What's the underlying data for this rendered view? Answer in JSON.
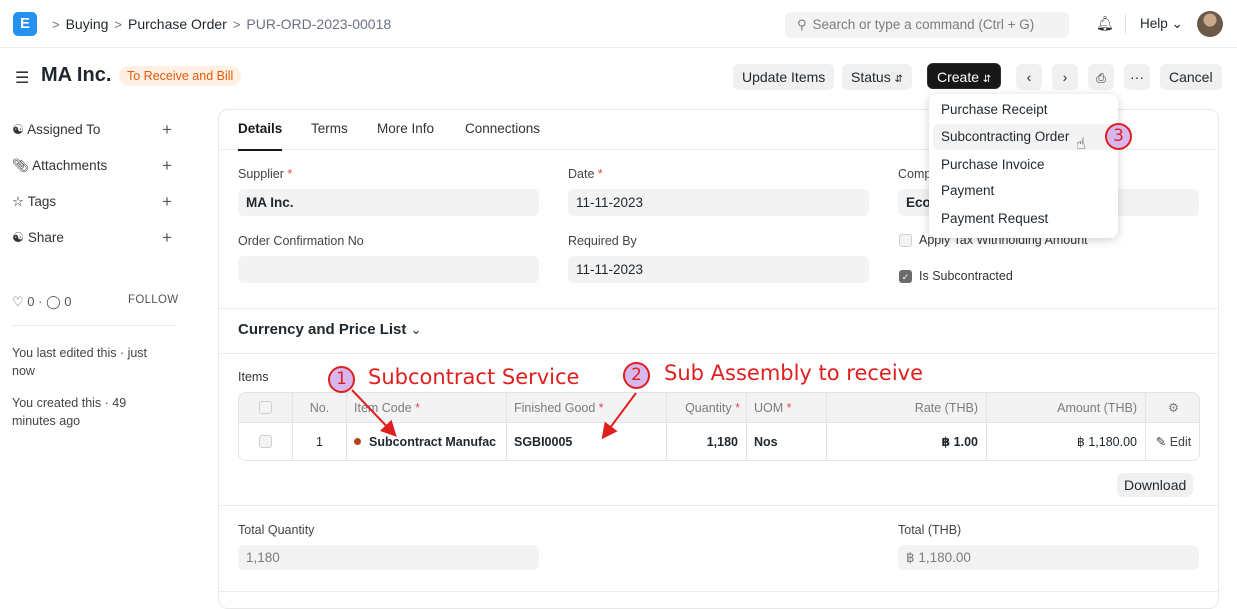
{
  "nav": {
    "logo": "E",
    "breadcrumbs": [
      "Buying",
      "Purchase Order",
      "PUR-ORD-2023-00018"
    ],
    "search_placeholder": "Search or type a command (Ctrl + G)",
    "help": "Help"
  },
  "header": {
    "title": "MA Inc.",
    "status": "To Receive and Bill",
    "buttons": {
      "update_items": "Update Items",
      "status": "Status",
      "create": "Create",
      "cancel": "Cancel",
      "more": "···"
    }
  },
  "sidebar": {
    "items": [
      {
        "label": "Assigned To"
      },
      {
        "label": "Attachments"
      },
      {
        "label": "Tags"
      },
      {
        "label": "Share"
      }
    ],
    "likes": "0",
    "comments": "0",
    "follow": "FOLLOW",
    "last_edited": "You last edited this · just now",
    "created": "You created this · 49 minutes ago"
  },
  "tabs": [
    "Details",
    "Terms",
    "More Info",
    "Connections"
  ],
  "form": {
    "supplier_label": "Supplier",
    "supplier_value": "MA Inc.",
    "date_label": "Date",
    "date_value": "11-11-2023",
    "company_label": "Comp",
    "company_value": "Eco",
    "order_conf_label": "Order Confirmation No",
    "order_conf_value": "",
    "required_by_label": "Required By",
    "required_by_value": "11-11-2023",
    "apply_tax_label": "Apply Tax Withholding Amount",
    "apply_tax_checked": false,
    "is_subcontracted_label": "Is Subcontracted",
    "is_subcontracted_checked": true
  },
  "currency_section": "Currency and Price List",
  "items_table": {
    "label": "Items",
    "columns": [
      "No.",
      "Item Code",
      "Finished Good",
      "Quantity",
      "UOM",
      "Rate (THB)",
      "Amount (THB)"
    ],
    "rows": [
      {
        "no": "1",
        "item_code": "Subcontract Manufac",
        "finished_good": "SGBI0005",
        "quantity": "1,180",
        "uom": "Nos",
        "rate": "฿ 1.00",
        "amount": "฿ 1,180.00",
        "edit": "Edit"
      }
    ],
    "download": "Download"
  },
  "totals": {
    "qty_label": "Total Quantity",
    "qty_value": "1,180",
    "total_label": "Total (THB)",
    "total_value": "฿ 1,180.00"
  },
  "create_menu": [
    "Purchase Receipt",
    "Subcontracting Order",
    "Purchase Invoice",
    "Payment",
    "Payment Request"
  ],
  "annotations": {
    "one_num": "1",
    "one_text": "Subcontract Service",
    "two_num": "2",
    "two_text": "Sub Assembly to receive",
    "three_num": "3"
  },
  "colors": {
    "accent": "#2490ef",
    "annotation": "#e01f1f",
    "status_badge": "#e55b0b"
  }
}
